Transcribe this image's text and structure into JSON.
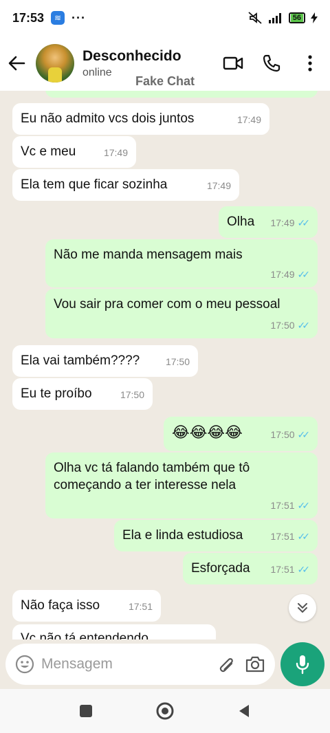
{
  "status_bar": {
    "time": "17:53",
    "dots": "···",
    "battery": "56"
  },
  "header": {
    "name": "Desconhecido",
    "status": "online",
    "watermark": "Fake Chat"
  },
  "messages": [
    {
      "dir": "in",
      "text": "Eu não admito vcs dois juntos",
      "time": "17:49"
    },
    {
      "dir": "in",
      "text": "Vc e meu",
      "time": "17:49"
    },
    {
      "dir": "in",
      "text": "Ela tem que ficar sozinha",
      "time": "17:49"
    },
    {
      "dir": "out",
      "text": "Olha",
      "time": "17:49"
    },
    {
      "dir": "out",
      "text": "Não me manda mensagem mais",
      "time": "17:49"
    },
    {
      "dir": "out",
      "text": "Vou sair pra comer com o meu pessoal",
      "time": "17:50"
    },
    {
      "dir": "in",
      "text": "Ela vai também????",
      "time": "17:50"
    },
    {
      "dir": "in",
      "text": "Eu te proíbo",
      "time": "17:50"
    },
    {
      "dir": "out",
      "text": "😂😂😂😂",
      "time": "17:50"
    },
    {
      "dir": "out",
      "text": "Olha vc tá falando também que tô começando a ter interesse nela",
      "time": "17:51"
    },
    {
      "dir": "out",
      "text": "Ela e linda estudiosa",
      "time": "17:51"
    },
    {
      "dir": "out",
      "text": "Esforçada",
      "time": "17:51"
    },
    {
      "dir": "in",
      "text": "Não faça isso",
      "time": "17:51"
    },
    {
      "dir": "in",
      "text": "Vc não tá entendendo",
      "time": ""
    }
  ],
  "input": {
    "placeholder": "Mensagem"
  },
  "colors": {
    "incoming": "#ffffff",
    "outgoing": "#d9fdd3",
    "background": "#efeae2",
    "accent": "#1aa37a",
    "ticks": "#53bdeb"
  },
  "icons": [
    "back-arrow-icon",
    "video-call-icon",
    "phone-icon",
    "more-options-icon",
    "emoji-icon",
    "attach-icon",
    "camera-icon",
    "mic-icon",
    "scroll-down-icon",
    "nav-recents-icon",
    "nav-home-icon",
    "nav-back-icon"
  ]
}
